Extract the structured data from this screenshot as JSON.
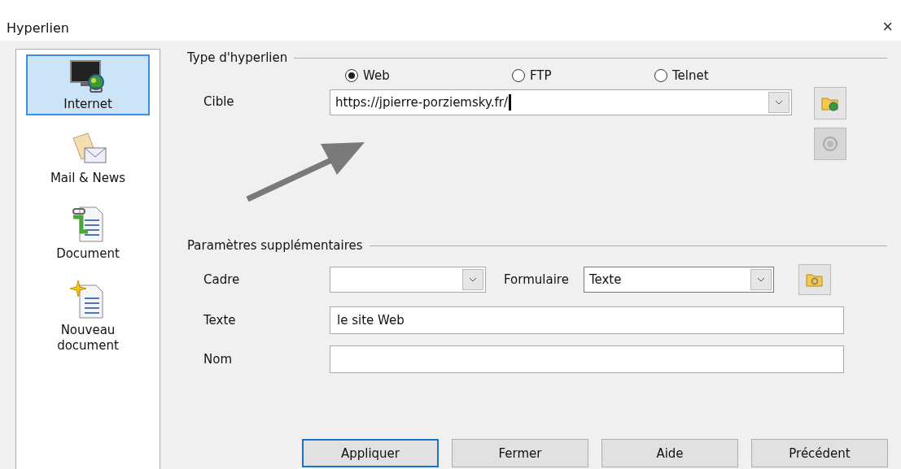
{
  "window": {
    "title": "Hyperlien",
    "close": "×"
  },
  "sidebar": {
    "items": [
      {
        "label": "Internet",
        "selected": true
      },
      {
        "label": "Mail & News",
        "selected": false
      },
      {
        "label": "Document",
        "selected": false
      },
      {
        "label": "Nouveau document",
        "selected": false
      }
    ]
  },
  "hyperlink_type": {
    "title": "Type d'hyperlien",
    "options": [
      {
        "label": "Web",
        "selected": true
      },
      {
        "label": "FTP",
        "selected": false
      },
      {
        "label": "Telnet",
        "selected": false
      }
    ],
    "target": {
      "label": "Cible",
      "value": "https://jpierre-porziemsky.fr/"
    },
    "open_button": {
      "disabled": false
    },
    "second_button": {
      "disabled": true
    }
  },
  "annotation": {
    "kind": "arrow"
  },
  "extra": {
    "title": "Paramètres supplémentaires",
    "frame": {
      "label": "Cadre"
    },
    "form": {
      "label": "Formulaire",
      "value": "Texte"
    },
    "text": {
      "label": "Texte",
      "value": "le site Web"
    },
    "name": {
      "label": "Nom"
    }
  },
  "buttons": [
    {
      "label": "Appliquer",
      "focused": true
    },
    {
      "label": "Fermer",
      "focused": false
    },
    {
      "label": "Aide",
      "focused": false
    },
    {
      "label": "Précédent",
      "focused": false
    }
  ]
}
